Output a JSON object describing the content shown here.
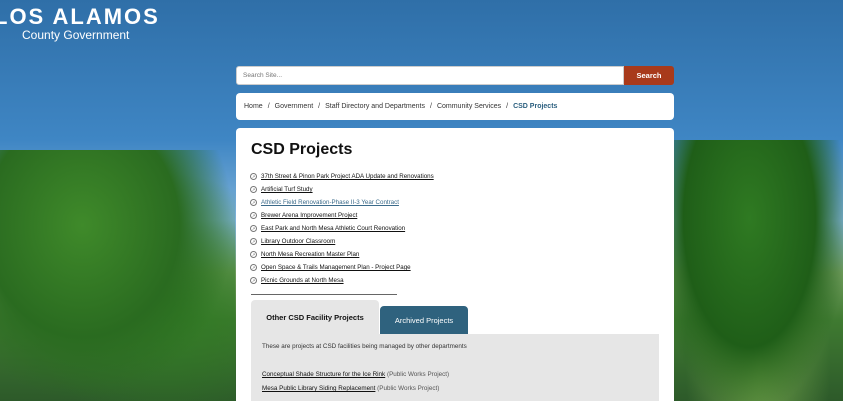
{
  "logo": {
    "line1": "LOS ALAMOS",
    "line2": "County Government"
  },
  "search": {
    "placeholder": "Search Site...",
    "button": "Search"
  },
  "breadcrumb": {
    "items": [
      "Home",
      "Government",
      "Staff Directory and Departments",
      "Community Services"
    ],
    "separator": "/",
    "current": "CSD Projects"
  },
  "page": {
    "title": "CSD Projects"
  },
  "projects": [
    "37th Street & Pinon Park Project ADA Update and Renovations",
    "Artificial Turf Study",
    "Athletic Field Renovation-Phase II-3 Year Contract",
    "Brewer Arena Improvement Project",
    "East Park and North Mesa Athletic Court Renovation",
    "Library Outdoor Classroom",
    "North Mesa Recreation Master Plan",
    "Open Space & Trails Management Plan - Project Page",
    "Picnic Grounds at North Mesa"
  ],
  "tabs": {
    "active": "Other CSD Facility Projects",
    "other": "Archived Projects"
  },
  "panel": {
    "description": "These are projects at CSD facilities being managed by other departments",
    "items": [
      {
        "link": "Conceptual Shade Structure for the Ice Rink",
        "note": "(Public Works Project)"
      },
      {
        "link": "Mesa Public Library Siding Replacement",
        "note": "(Public Works Project)"
      }
    ]
  },
  "colors": {
    "search_button": "#a83a1b",
    "tab_active_bg": "#e6e6e6",
    "tab_other_bg": "#2f627e",
    "current_crumb": "#2b5f7f"
  }
}
